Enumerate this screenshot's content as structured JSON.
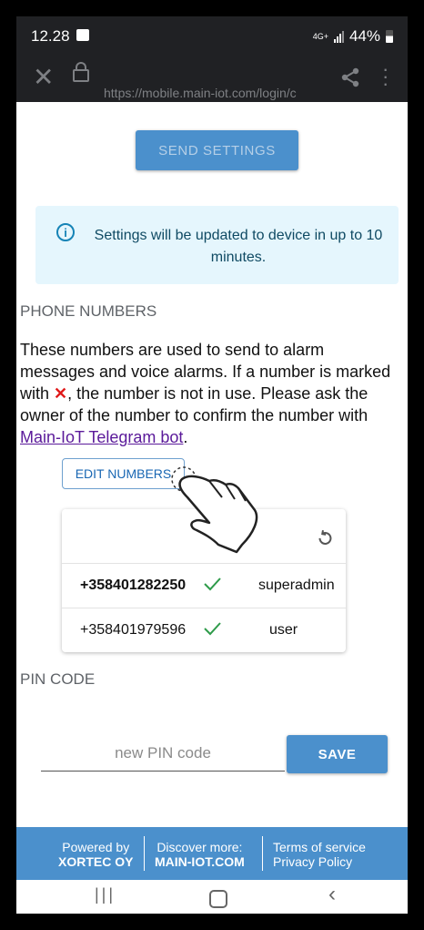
{
  "status_bar": {
    "time": "12.28",
    "network": "4G+",
    "battery": "44%"
  },
  "browser": {
    "url": "https://mobile.main-iot.com/login/c"
  },
  "send_settings": {
    "label": "SEND SETTINGS"
  },
  "info": {
    "message": "Settings will be updated to device in up to 10 minutes."
  },
  "phone_numbers": {
    "title": "PHONE NUMBERS",
    "description_before": "These numbers are used to send to alarm messages and voice alarms. If a number is marked with ",
    "description_mark": "✕",
    "description_after": ", the number is not in use. Please ask the owner of the number to confirm the number with ",
    "link_text": "Main-IoT Telegram bot",
    "period": ".",
    "edit_label": "EDIT NUMBERS",
    "rows": [
      {
        "number": "+358401282250",
        "confirmed": "✓",
        "role": "superadmin"
      },
      {
        "number": "+358401979596",
        "confirmed": "✓",
        "role": "user"
      }
    ]
  },
  "pin_code": {
    "title": "PIN CODE",
    "placeholder": "new PIN code",
    "save_label": "SAVE"
  },
  "footer": {
    "powered_by": "Powered by",
    "company": "XORTEC OY",
    "discover": "Discover more:",
    "site": "MAIN-IOT.COM",
    "terms": "Terms of service",
    "privacy": "Privacy Policy"
  },
  "colors": {
    "primary": "#4b90cc",
    "info_bg": "#e5f6fd",
    "check": "#2e9b4a",
    "link": "#5b1a9a"
  },
  "icons": {
    "close": "close-icon",
    "lock": "lock-icon",
    "share": "share-icon",
    "menu": "more-vert-icon",
    "info": "info-icon",
    "refresh": "refresh-icon",
    "check": "checkmark-icon",
    "pointer": "hand-pointer-icon"
  }
}
